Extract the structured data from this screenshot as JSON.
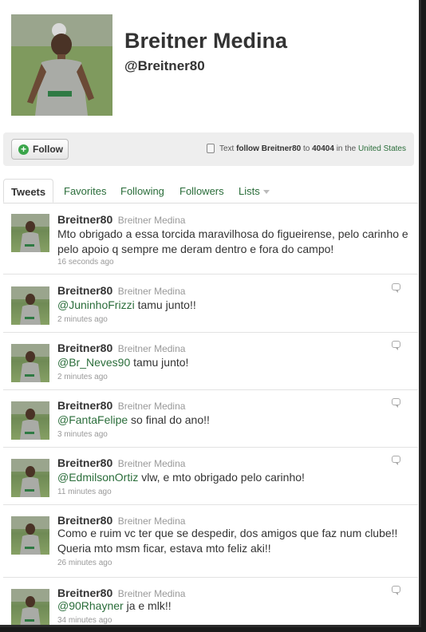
{
  "profile": {
    "name": "Breitner Medina",
    "handle": "@Breitner80"
  },
  "actions": {
    "follow_label": "Follow",
    "sms_prefix": "Text",
    "sms_command": "follow Breitner80",
    "sms_to": "to",
    "sms_number": "40404",
    "sms_in": "in the",
    "sms_country": "United States"
  },
  "tabs": [
    {
      "label": "Tweets"
    },
    {
      "label": "Favorites"
    },
    {
      "label": "Following"
    },
    {
      "label": "Followers"
    },
    {
      "label": "Lists"
    }
  ],
  "tweets": [
    {
      "user": "Breitner80",
      "full_name": "Breitner Medina",
      "mention": "",
      "text": "Mto obrigado a essa torcida maravilhosa do figueirense, pelo carinho e pelo apoio q sempre me deram dentro e fora do campo!",
      "time": "16 seconds ago"
    },
    {
      "user": "Breitner80",
      "full_name": "Breitner Medina",
      "mention": "@JuninhoFrizzi",
      "text": " tamu junto!!",
      "time": "2 minutes ago"
    },
    {
      "user": "Breitner80",
      "full_name": "Breitner Medina",
      "mention": "@Br_Neves90",
      "text": " tamu junto!",
      "time": "2 minutes ago"
    },
    {
      "user": "Breitner80",
      "full_name": "Breitner Medina",
      "mention": "@FantaFelipe",
      "text": " so final do ano!!",
      "time": "3 minutes ago"
    },
    {
      "user": "Breitner80",
      "full_name": "Breitner Medina",
      "mention": "@EdmilsonOrtiz",
      "text": " vlw, e mto obrigado pelo carinho!",
      "time": "11 minutes ago"
    },
    {
      "user": "Breitner80",
      "full_name": "Breitner Medina",
      "mention": "",
      "text": "Como e ruim vc ter que se despedir, dos amigos que faz num clube!! Queria mto msm ficar, estava mto feliz aki!!",
      "time": "26 minutes ago"
    },
    {
      "user": "Breitner80",
      "full_name": "Breitner Medina",
      "mention": "@90Rhayner",
      "text": " ja e mlk!!",
      "time": "34 minutes ago"
    }
  ],
  "colors": {
    "link": "#2a6d3a",
    "follow_icon": "#3aa54a"
  }
}
